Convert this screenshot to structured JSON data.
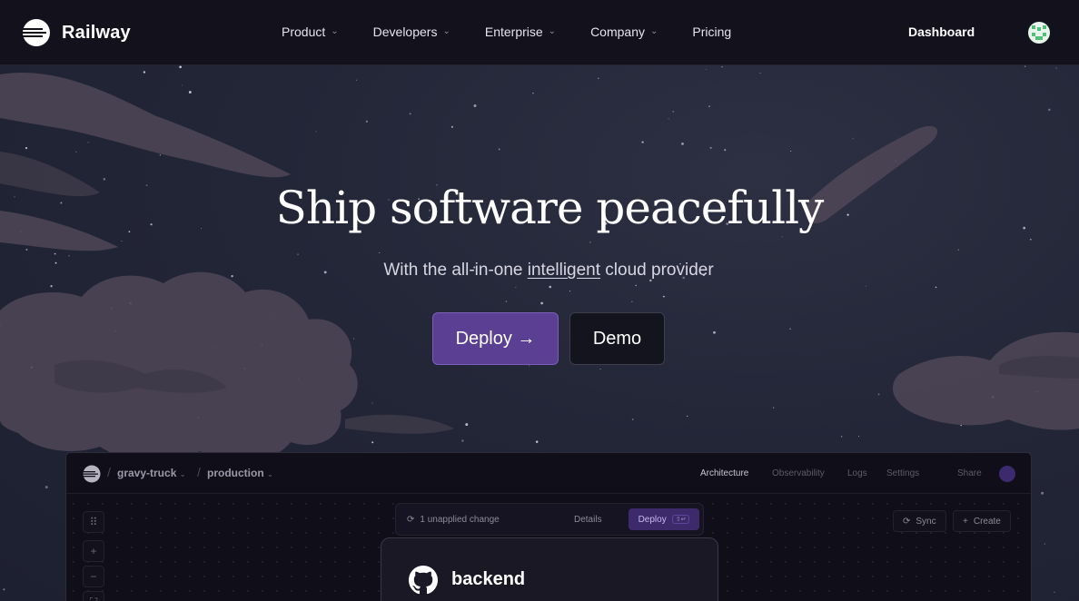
{
  "nav": {
    "brand": "Railway",
    "items": [
      {
        "label": "Product",
        "has_dropdown": true
      },
      {
        "label": "Developers",
        "has_dropdown": true
      },
      {
        "label": "Enterprise",
        "has_dropdown": true
      },
      {
        "label": "Company",
        "has_dropdown": true
      },
      {
        "label": "Pricing",
        "has_dropdown": false
      }
    ],
    "dashboard": "Dashboard"
  },
  "hero": {
    "title": "Ship software peacefully",
    "subtitle_before": "With the all-in-one ",
    "subtitle_link": "intelligent",
    "subtitle_after": " cloud provider",
    "deploy_button": "Deploy →",
    "demo_button": "Demo"
  },
  "preview": {
    "project": "gravy-truck",
    "environment": "production",
    "tabs": [
      {
        "label": "Architecture",
        "active": true
      },
      {
        "label": "Observability",
        "active": false
      },
      {
        "label": "Logs",
        "active": false
      },
      {
        "label": "Settings",
        "active": false
      },
      {
        "label": "Share",
        "active": false
      }
    ],
    "change_text": "1 unapplied change",
    "details_label": "Details",
    "deploy_label": "Deploy",
    "deploy_shortcut": "⇧↵",
    "sync_label": "Sync",
    "create_label": "Create",
    "service_name": "backend"
  },
  "colors": {
    "nav_bg": "#13111c",
    "accent_purple": "#5b3f93",
    "sky": "#232637",
    "cloud": "#4f4657"
  }
}
